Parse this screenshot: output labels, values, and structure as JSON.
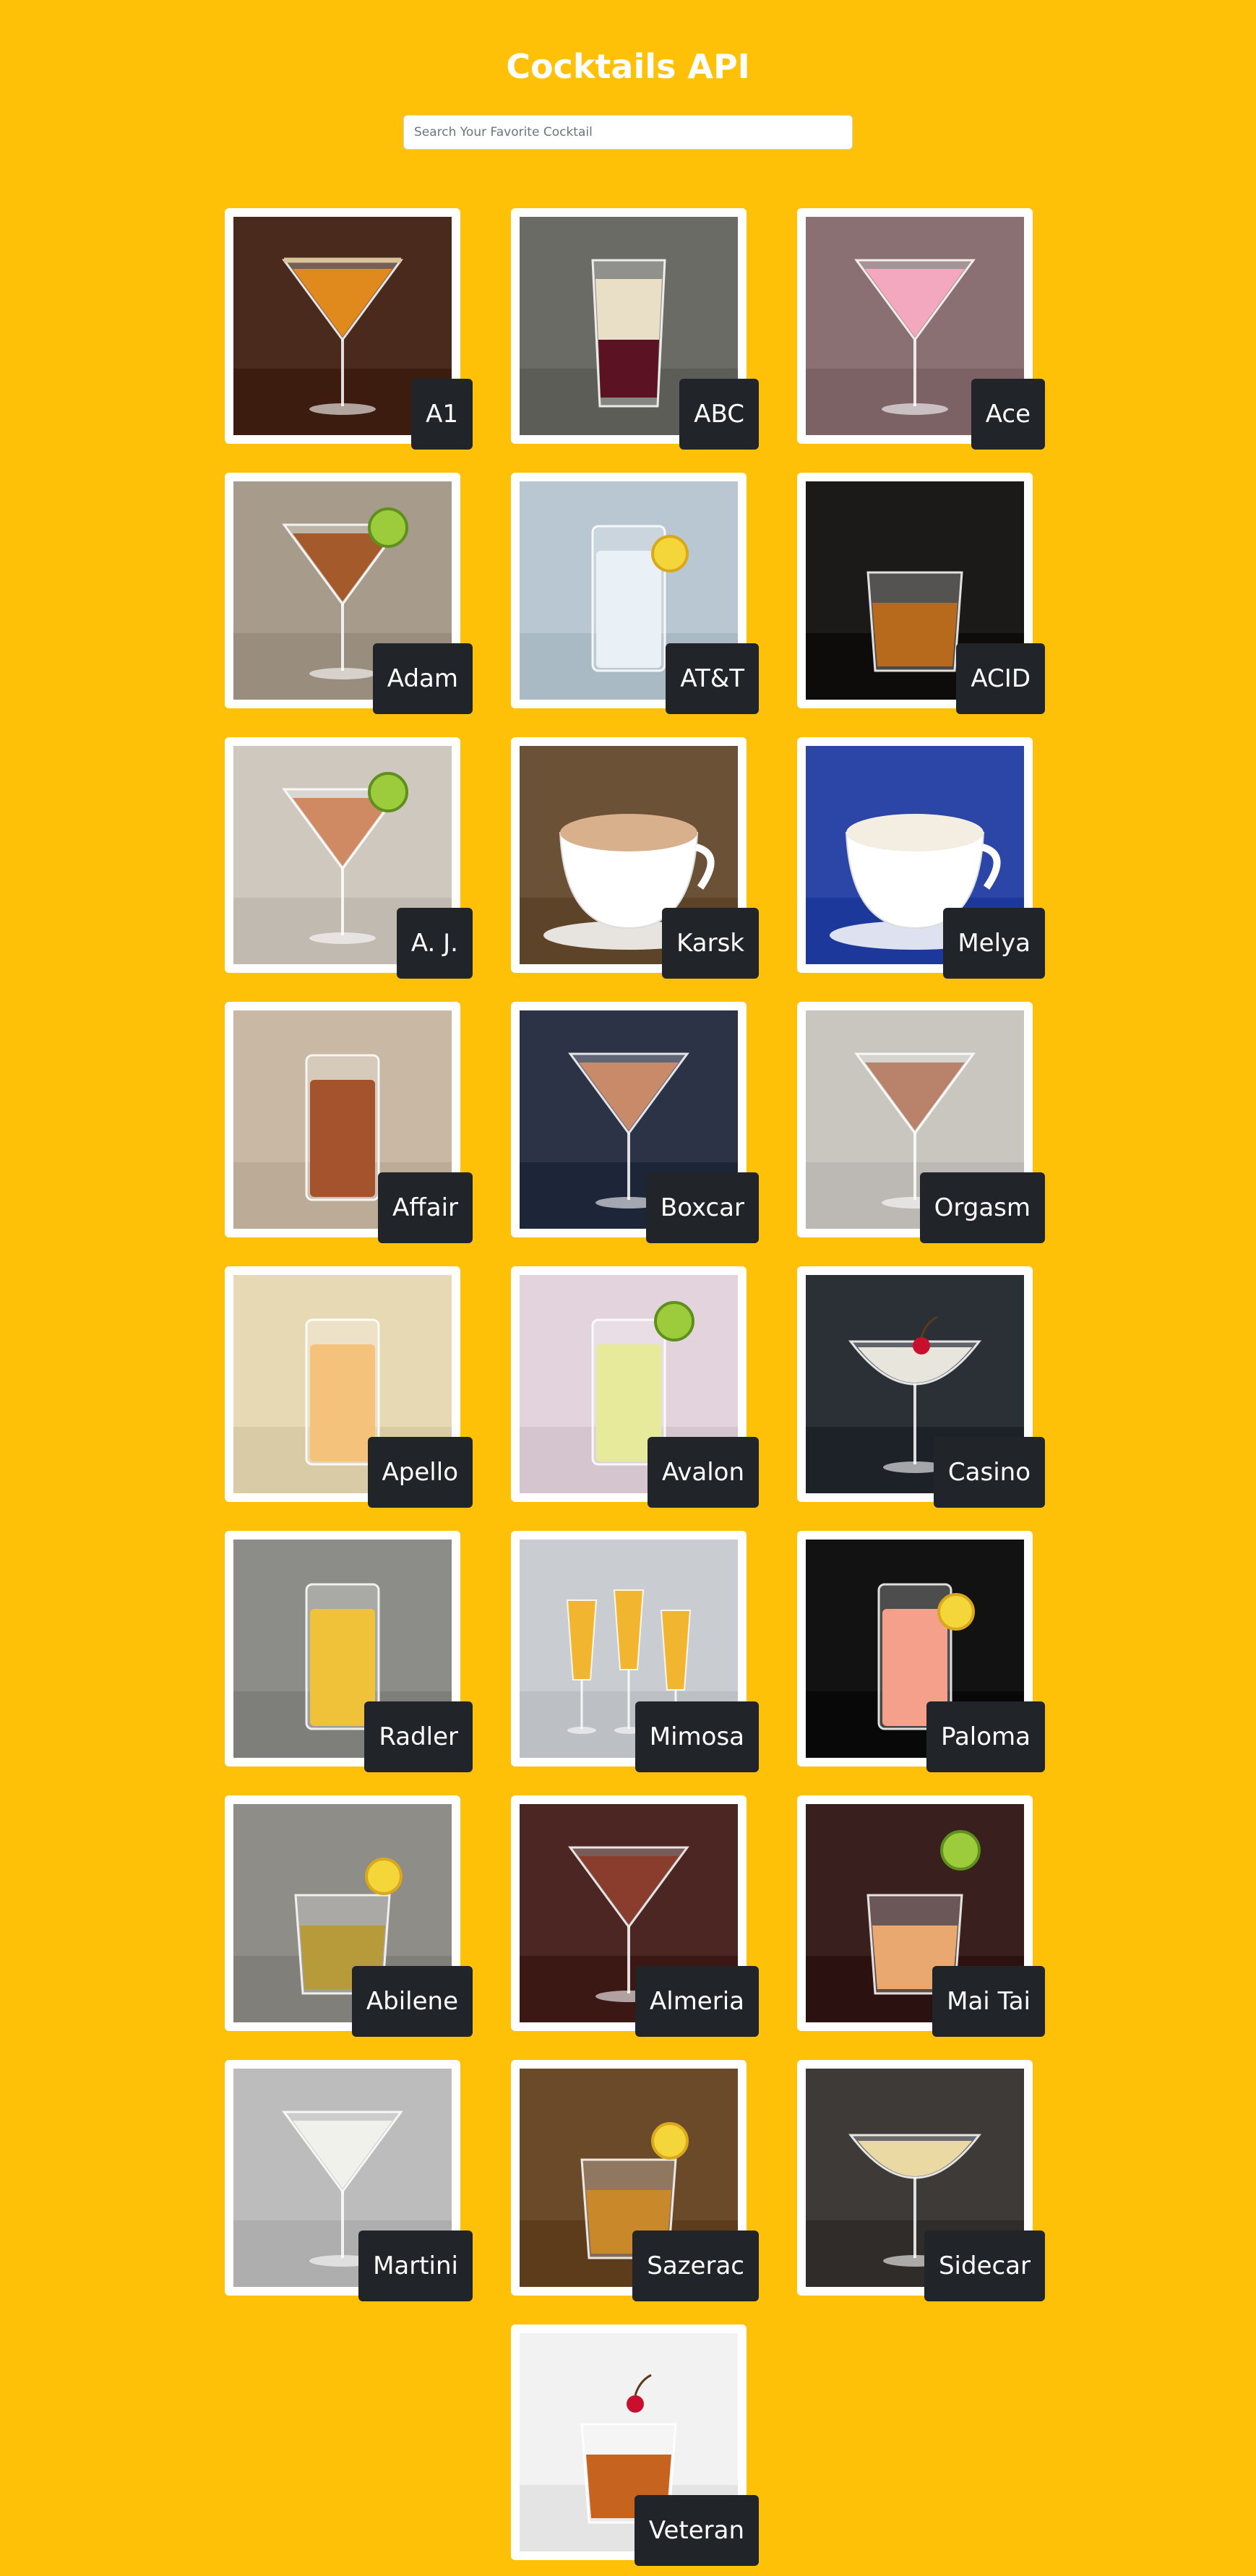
{
  "header": {
    "title": "Cocktails API"
  },
  "search": {
    "placeholder": "Search Your Favorite Cocktail",
    "value": ""
  },
  "cocktails": [
    {
      "name": "A1",
      "bg": "#4a2a1c",
      "liquid": "#e08a1e",
      "glass": "martini",
      "garnish": "rim"
    },
    {
      "name": "ABC",
      "bg": "#6b6b66",
      "liquid": "#e9dfc6",
      "glass": "shot",
      "garnish": "none"
    },
    {
      "name": "Ace",
      "bg": "#8a6f73",
      "liquid": "#f3a8bf",
      "glass": "martini",
      "garnish": "none"
    },
    {
      "name": "Adam",
      "bg": "#a79b8b",
      "liquid": "#a45a2a",
      "glass": "martini",
      "garnish": "lime"
    },
    {
      "name": "AT&T",
      "bg": "#b8c7d2",
      "liquid": "#e9f1f6",
      "glass": "highball",
      "garnish": "lemon"
    },
    {
      "name": "ACID",
      "bg": "#1c1a18",
      "liquid": "#b76a1c",
      "glass": "rocks",
      "garnish": "none"
    },
    {
      "name": "A. J.",
      "bg": "#cfc8bf",
      "liquid": "#d08a63",
      "glass": "martini",
      "garnish": "lime"
    },
    {
      "name": "Karsk",
      "bg": "#6b5136",
      "liquid": "#d9b08c",
      "glass": "cup",
      "garnish": "none"
    },
    {
      "name": "Melya",
      "bg": "#2c46a8",
      "liquid": "#f4eee2",
      "glass": "cup",
      "garnish": "none"
    },
    {
      "name": "Affair",
      "bg": "#c9b9a4",
      "liquid": "#a4532c",
      "glass": "highball",
      "garnish": "none"
    },
    {
      "name": "Boxcar",
      "bg": "#2c3347",
      "liquid": "#c98a6a",
      "glass": "martini",
      "garnish": "none"
    },
    {
      "name": "Orgasm",
      "bg": "#c9c6c0",
      "liquid": "#b9826a",
      "glass": "martini",
      "garnish": "none"
    },
    {
      "name": "Apello",
      "bg": "#e7d9b4",
      "liquid": "#f4c27a",
      "glass": "highball",
      "garnish": "none"
    },
    {
      "name": "Avalon",
      "bg": "#e2d3dc",
      "liquid": "#e7ea9a",
      "glass": "highball",
      "garnish": "lime"
    },
    {
      "name": "Casino",
      "bg": "#2b3036",
      "liquid": "#e8e6dc",
      "glass": "coupe",
      "garnish": "cherry"
    },
    {
      "name": "Radler",
      "bg": "#8c8c88",
      "liquid": "#f0c23a",
      "glass": "highball",
      "garnish": "none"
    },
    {
      "name": "Mimosa",
      "bg": "#c9cdd1",
      "liquid": "#f2b530",
      "glass": "flute",
      "garnish": "none"
    },
    {
      "name": "Paloma",
      "bg": "#121212",
      "liquid": "#f4a08a",
      "glass": "highball",
      "garnish": "lemon"
    },
    {
      "name": "Abilene",
      "bg": "#8e8d88",
      "liquid": "#b79a3a",
      "glass": "rocks",
      "garnish": "lemon"
    },
    {
      "name": "Almeria",
      "bg": "#4b2622",
      "liquid": "#8a3d2c",
      "glass": "martini",
      "garnish": "none"
    },
    {
      "name": "Mai Tai",
      "bg": "#3a1f1f",
      "liquid": "#e8a870",
      "glass": "rocks",
      "garnish": "lime"
    },
    {
      "name": "Martini",
      "bg": "#bcbcbc",
      "liquid": "#f1f1ec",
      "glass": "martini",
      "garnish": "none"
    },
    {
      "name": "Sazerac",
      "bg": "#6b4a2a",
      "liquid": "#c9892a",
      "glass": "rocks",
      "garnish": "lemon"
    },
    {
      "name": "Sidecar",
      "bg": "#3d3a38",
      "liquid": "#ead9a2",
      "glass": "coupe",
      "garnish": "none"
    },
    {
      "name": "Veteran",
      "bg": "#f2f2f2",
      "liquid": "#c6631f",
      "glass": "rocks",
      "garnish": "cherry"
    }
  ]
}
